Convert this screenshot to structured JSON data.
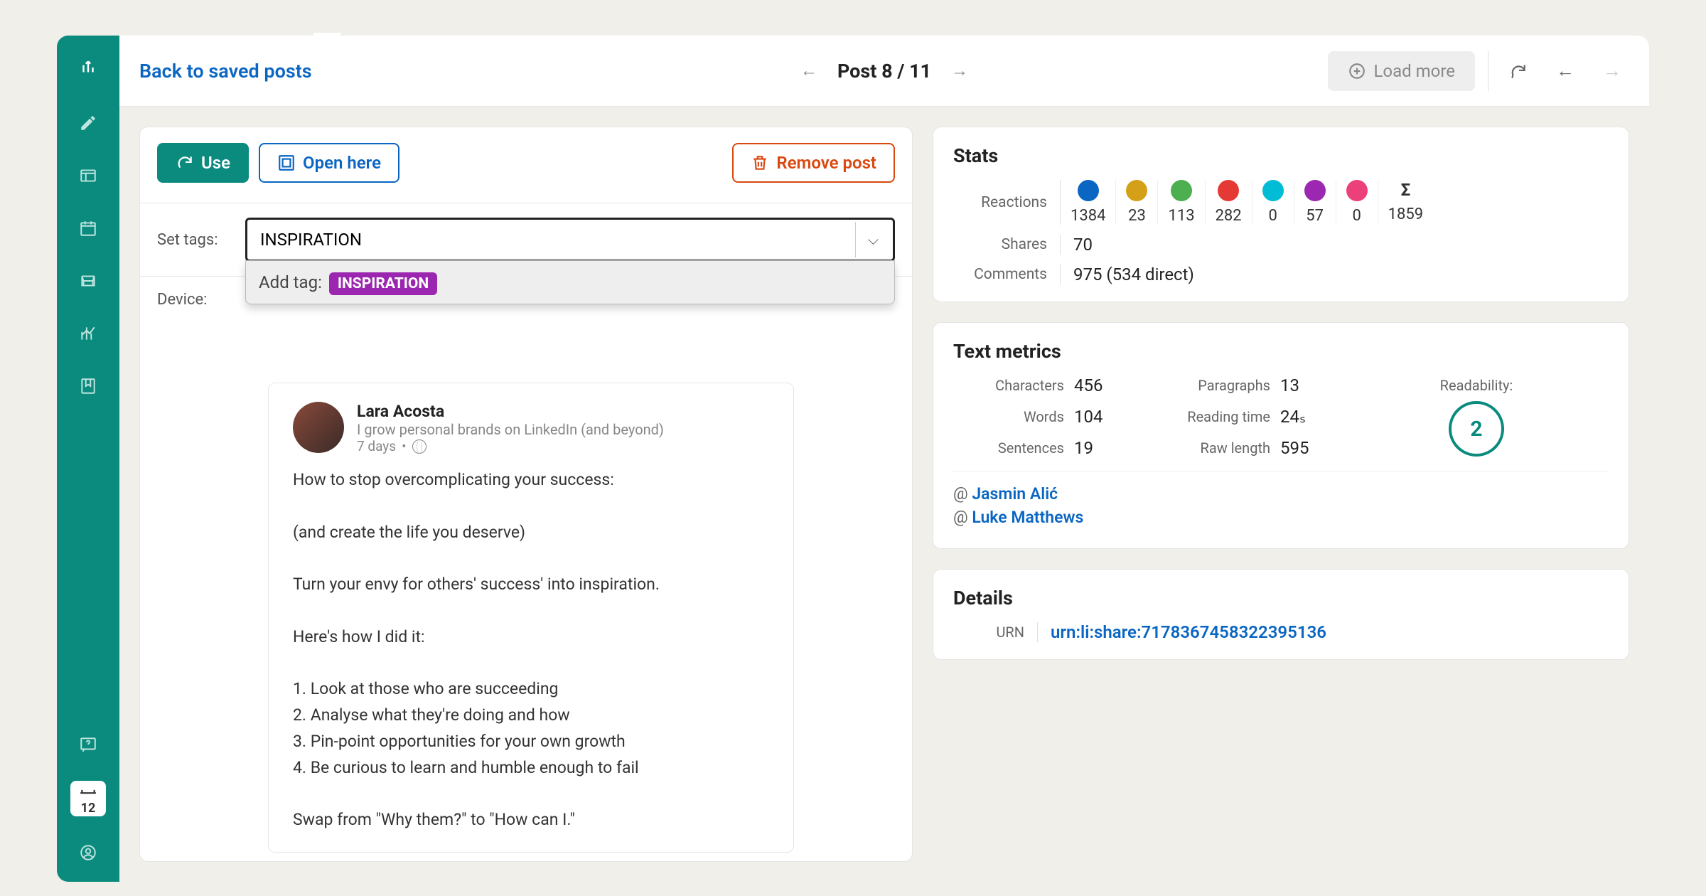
{
  "nav": {
    "back": "Back to saved posts",
    "pager_prefix": "Post ",
    "pager_pos": "8 / 11",
    "load_more": "Load more",
    "calendar_day": "12"
  },
  "toolbar": {
    "use": "Use",
    "open": "Open here",
    "remove": "Remove post"
  },
  "tags": {
    "label": "Set tags:",
    "value": "INSPIRATION",
    "dropdown_prefix": "Add tag:",
    "dropdown_tag": "INSPIRATION"
  },
  "device": {
    "label": "Device:"
  },
  "post": {
    "author": "Lara Acosta",
    "tagline": "I grow personal brands on LinkedIn (and beyond)",
    "age": "7 days",
    "body": "How to stop overcomplicating your success:\n\n(and create the life you deserve)\n\nTurn your envy for others' success' into inspiration.\n\nHere's how I did it:\n\n1. Look at those who are succeeding\n2. Analyse what they're doing and how\n3. Pin-point opportunities for your own growth\n4. Be curious to learn and humble enough to fail\n\nSwap from \"Why them?\" to \"How can I.\""
  },
  "stats": {
    "title": "Stats",
    "labels": {
      "reactions": "Reactions",
      "shares": "Shares",
      "comments": "Comments"
    },
    "reactions": [
      {
        "name": "like",
        "color": "#0a66c2",
        "val": "1384"
      },
      {
        "name": "celebrate",
        "color": "#d4a017",
        "val": "23"
      },
      {
        "name": "support",
        "color": "#4caf50",
        "val": "113"
      },
      {
        "name": "love",
        "color": "#e53935",
        "val": "282"
      },
      {
        "name": "insightful",
        "color": "#00bcd4",
        "val": "0"
      },
      {
        "name": "funny",
        "color": "#9c27b0",
        "val": "57"
      },
      {
        "name": "curious",
        "color": "#ec407a",
        "val": "0"
      }
    ],
    "total": "1859",
    "shares": "70",
    "comments": "975 (534 direct)"
  },
  "metrics": {
    "title": "Text metrics",
    "rows": {
      "characters": {
        "label": "Characters",
        "val": "456"
      },
      "words": {
        "label": "Words",
        "val": "104"
      },
      "sentences": {
        "label": "Sentences",
        "val": "19"
      },
      "paragraphs": {
        "label": "Paragraphs",
        "val": "13"
      },
      "reading": {
        "label": "Reading time",
        "val": "24ₛ"
      },
      "raw": {
        "label": "Raw length",
        "val": "595"
      }
    },
    "readability": {
      "label": "Readability:",
      "val": "2"
    },
    "mentions": [
      "Jasmin Alić",
      "Luke Matthews"
    ]
  },
  "details": {
    "title": "Details",
    "urn_label": "URN",
    "urn": "urn:li:share:7178367458322395136"
  }
}
